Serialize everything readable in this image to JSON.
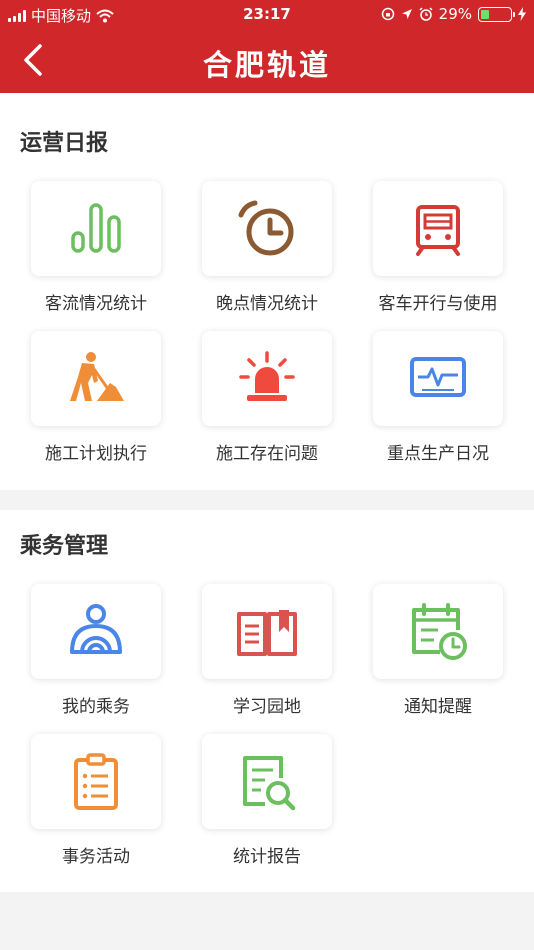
{
  "status_bar": {
    "carrier": "中国移动",
    "time": "23:17",
    "battery": "29%",
    "battery_level": 0.29
  },
  "header": {
    "title": "合肥轨道"
  },
  "sections": [
    {
      "title": "运营日报",
      "items": [
        {
          "label": "客流情况统计",
          "icon": "bar-chart-icon",
          "color": "#6cbf5e"
        },
        {
          "label": "晚点情况统计",
          "icon": "alarm-clock-icon",
          "color": "#8b5a32"
        },
        {
          "label": "客车开行与使用",
          "icon": "train-icon",
          "color": "#d43b36"
        },
        {
          "label": "施工计划执行",
          "icon": "construction-worker-icon",
          "color": "#ef8e36"
        },
        {
          "label": "施工存在问题",
          "icon": "siren-icon",
          "color": "#ef4a3d"
        },
        {
          "label": "重点生产日况",
          "icon": "monitor-icon",
          "color": "#4a86e8"
        }
      ]
    },
    {
      "title": "乘务管理",
      "items": [
        {
          "label": "我的乘务",
          "icon": "driver-icon",
          "color": "#4a86e8"
        },
        {
          "label": "学习园地",
          "icon": "book-icon",
          "color": "#d9534f"
        },
        {
          "label": "通知提醒",
          "icon": "calendar-clock-icon",
          "color": "#6cbf5e"
        },
        {
          "label": "事务活动",
          "icon": "clipboard-icon",
          "color": "#ef8e36"
        },
        {
          "label": "统计报告",
          "icon": "document-search-icon",
          "color": "#6cbf5e"
        }
      ]
    }
  ]
}
